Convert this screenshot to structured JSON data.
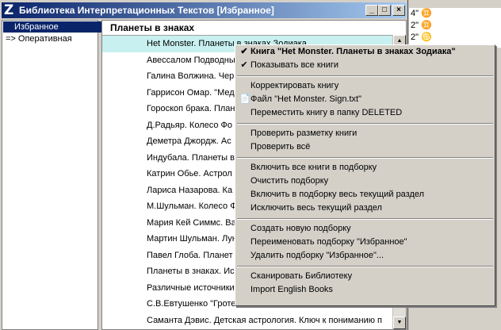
{
  "window": {
    "title": "Библиотека Интерпретационных Текстов [Избранное]",
    "icon_letter": "Z",
    "btn_min": "_",
    "btn_max": "□",
    "btn_close": "×"
  },
  "left_panel": {
    "items": [
      {
        "label": "Избранное"
      },
      {
        "label": "=> Оперативная"
      }
    ]
  },
  "list": {
    "header": "Планеты в знаках",
    "rows": [
      "Het Monster. Планеты в знаках Зодиака",
      "Авессалом Подводный",
      "Галина Волжина. Чер",
      "Гаррисон Омар. \"Мед",
      "Гороскоп брака. План",
      "Д.Радьяр. Колесо Фо",
      "Деметра Джордж. Ас",
      "Индубала. Планеты в",
      "Катрин Обье. Астрол",
      "Лариса Назарова. Ка",
      "М.Шульман. Колесо Ф",
      "Мария Кей Симмс. Ва",
      "Мартин Шульман. Лун",
      "Павел Глоба. Планет",
      "Планеты в знаках. Ис",
      "Различные источники",
      "С.В.Евтушенко \"Гроте",
      "Саманта Дэвис. Детская астрология. Ключ к пониманию п"
    ]
  },
  "behind_window": {
    "lines": [
      "4\" ♊",
      "2\" ♊",
      "2\" ♋"
    ]
  },
  "context_menu": {
    "items": [
      {
        "label": "Книга \"Het Monster. Планеты в знаках Зодиака\"",
        "bold": true,
        "mark": "✔"
      },
      {
        "label": "Показывать все книги",
        "mark": "✔"
      },
      {
        "sep": true
      },
      {
        "label": "Корректировать книгу"
      },
      {
        "label": "Файл \"Het Monster. Sign.txt\"",
        "mark": "📄"
      },
      {
        "label": "Переместить книгу в папку DELETED"
      },
      {
        "sep": true
      },
      {
        "label": "Проверить разметку книги"
      },
      {
        "label": "Проверить всё"
      },
      {
        "sep": true
      },
      {
        "label": "Включить все книги в подборку"
      },
      {
        "label": "Очистить подборку"
      },
      {
        "label": "Включить в подборку весь текущий раздел"
      },
      {
        "label": "Исключить весь текущий раздел"
      },
      {
        "sep": true
      },
      {
        "label": "Создать новую подборку"
      },
      {
        "label": "Переименовать подборку \"Избранное\""
      },
      {
        "label": "Удалить подборку \"Избранное\"..."
      },
      {
        "sep": true
      },
      {
        "label": "Сканировать Библиотеку"
      },
      {
        "label": "Import English Books"
      }
    ]
  }
}
